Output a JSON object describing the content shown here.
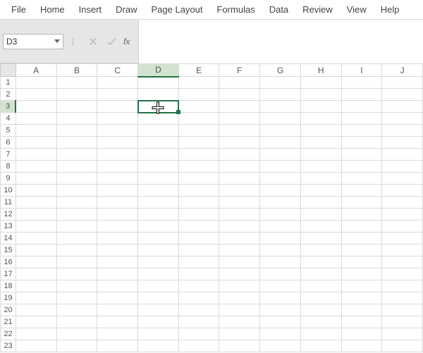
{
  "ribbon": {
    "tabs": [
      "File",
      "Home",
      "Insert",
      "Draw",
      "Page Layout",
      "Formulas",
      "Data",
      "Review",
      "View",
      "Help"
    ]
  },
  "formula_bar": {
    "name_box": "D3",
    "fx_label": "fx",
    "formula_value": ""
  },
  "grid": {
    "columns": [
      "A",
      "B",
      "C",
      "D",
      "E",
      "F",
      "G",
      "H",
      "I",
      "J"
    ],
    "rows": [
      "1",
      "2",
      "3",
      "4",
      "5",
      "6",
      "7",
      "8",
      "9",
      "10",
      "11",
      "12",
      "13",
      "14",
      "15",
      "16",
      "17",
      "18",
      "19",
      "20",
      "21",
      "22",
      "23"
    ],
    "active_cell": {
      "col": "D",
      "row": "3"
    },
    "cells": {}
  }
}
